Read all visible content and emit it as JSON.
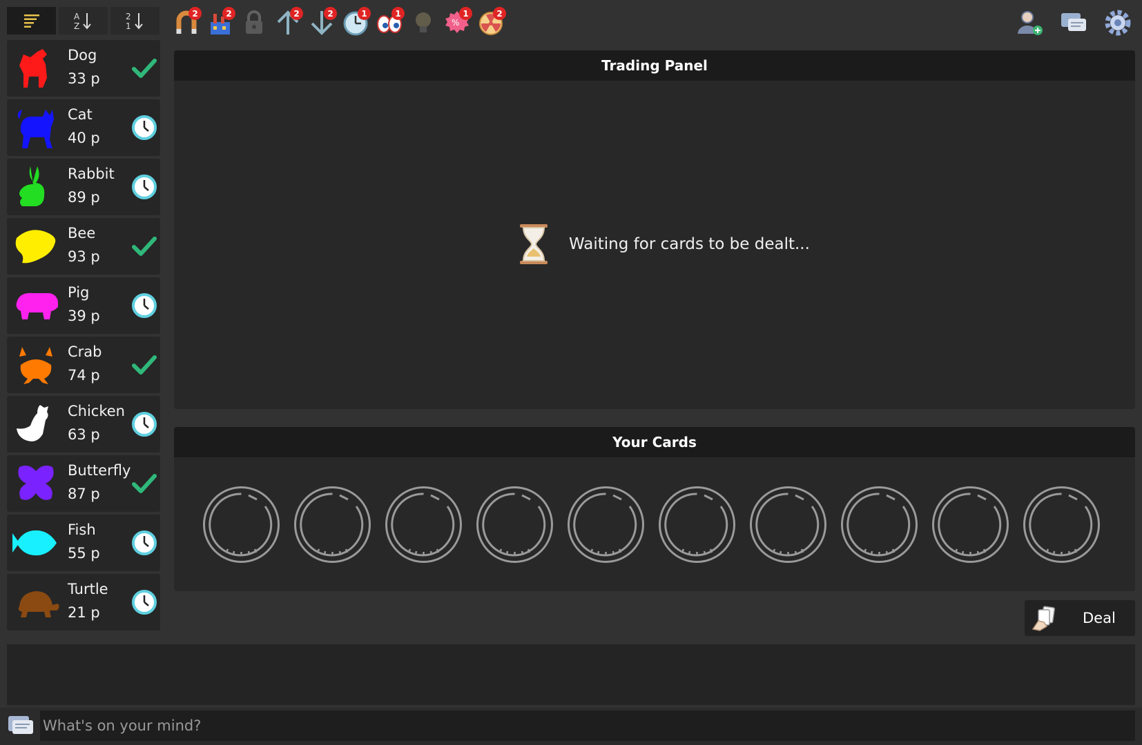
{
  "toolbar": {
    "sort_buttons": [
      {
        "name": "sort-default",
        "icon": "list-lines-icon"
      },
      {
        "name": "sort-alpha",
        "icon": "sort-az-icon"
      },
      {
        "name": "sort-numeric",
        "icon": "sort-21-icon"
      }
    ],
    "powerups": [
      {
        "icon": "magnet-icon",
        "count": "2"
      },
      {
        "icon": "factory-icon",
        "count": "2"
      },
      {
        "icon": "lock-icon",
        "count": ""
      },
      {
        "icon": "arrow-up-icon",
        "count": "2"
      },
      {
        "icon": "arrow-down-icon",
        "count": "2"
      },
      {
        "icon": "clock-icon",
        "count": "1"
      },
      {
        "icon": "eyes-icon",
        "count": "1"
      },
      {
        "icon": "lightbulb-icon",
        "count": ""
      },
      {
        "icon": "discount-badge-icon",
        "count": "1"
      },
      {
        "icon": "radiation-icon",
        "count": "2"
      }
    ],
    "right": [
      {
        "icon": "add-user-icon"
      },
      {
        "icon": "chat-bubbles-icon"
      },
      {
        "icon": "gear-icon"
      }
    ]
  },
  "animals": [
    {
      "name": "Dog",
      "points": "33 p",
      "color": "#ff1a1a",
      "status": "done"
    },
    {
      "name": "Cat",
      "points": "40 p",
      "color": "#1414ff",
      "status": "pending"
    },
    {
      "name": "Rabbit",
      "points": "89 p",
      "color": "#22dd22",
      "status": "pending"
    },
    {
      "name": "Bee",
      "points": "93 p",
      "color": "#ffee00",
      "status": "done"
    },
    {
      "name": "Pig",
      "points": "39 p",
      "color": "#ff22ee",
      "status": "pending"
    },
    {
      "name": "Crab",
      "points": "74 p",
      "color": "#ff7a00",
      "status": "done"
    },
    {
      "name": "Chicken",
      "points": "63 p",
      "color": "#ffffff",
      "status": "pending"
    },
    {
      "name": "Butterfly",
      "points": "87 p",
      "color": "#7a22ff",
      "status": "done"
    },
    {
      "name": "Fish",
      "points": "55 p",
      "color": "#18f0ff",
      "status": "pending"
    },
    {
      "name": "Turtle",
      "points": "21 p",
      "color": "#8a4a12",
      "status": "pending"
    }
  ],
  "trading_panel": {
    "title": "Trading Panel",
    "waiting_text": "Waiting for cards to be dealt..."
  },
  "your_cards": {
    "title": "Your Cards",
    "slots": 10
  },
  "deal_button": {
    "label": "Deal"
  },
  "chat": {
    "placeholder": "What's on your mind?"
  },
  "colors": {
    "background": "#323232",
    "panel": "#282828",
    "header": "#1b1b1b",
    "check": "#2fb87a",
    "clock": "#5fd0e0",
    "badge": "#e02424"
  }
}
